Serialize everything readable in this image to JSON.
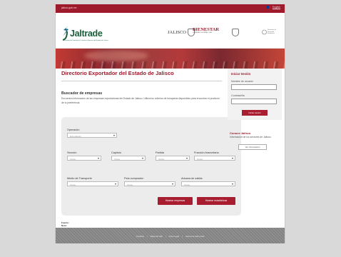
{
  "topbar": {
    "site": "jalisco.gob.mx",
    "lang": "English"
  },
  "header": {
    "logo_word": "Jaltrade",
    "logo_sub": "Instituto de Fomento al Comercio Exterior del Estado de Jalisco",
    "gov1": "JALISCO",
    "gov2": "BIENESTAR",
    "gov2_sub": "GOBIERNO ESTATAL QUE",
    "stamp": "Secretaría de Desarrollo Económico"
  },
  "main": {
    "title": "Directorio Exportador del Estado de Jalisco",
    "subtitle": "Buscador de empresas",
    "desc": "Encuentra información de las empresas exportadoras del Estado de Jalisco.  Utiliza los criterios de búsqueda disponibles para encontrar el producto de tu preferencia."
  },
  "search": {
    "operacion_label": "Operación",
    "operacion_value": "Exportación",
    "seccion_label": "Sección",
    "capitulo_label": "Capítulo",
    "partida_label": "Partida",
    "fraccion_label": "Fracción Arancelaria",
    "medio_label": "Medio de Transporte",
    "pais_label": "País comprador:",
    "aduana_label": "Aduana de salida:",
    "todos": "Todos",
    "btn_empresas": "Mostrar empresas",
    "btn_estadisticas": "Mostrar estadísticas",
    "fuente": "Fuente:",
    "nota": "Nota:"
  },
  "sidebar": {
    "login_title": "Iniciar Sesión",
    "user_label": "Nombre de usuario",
    "pass_label": "Contraseña",
    "login_btn": "Iniciar sesión",
    "info_title": "Conoce Jalisco",
    "info_text": "Información de los sectores de Jalisco.",
    "info_btn": "Ver información"
  },
  "footer": {
    "links": [
      "Contacto",
      "|",
      "Mapa del sitio",
      "|",
      "Aviso Legal",
      "|",
      "Acerca de este portal"
    ]
  },
  "colors": {
    "accent": "#9e1b2c",
    "button": "#a81d2f",
    "panel": "#ececec"
  }
}
